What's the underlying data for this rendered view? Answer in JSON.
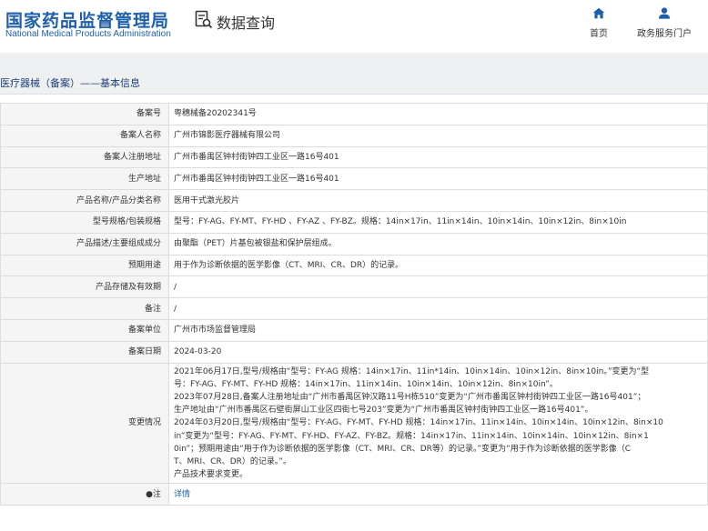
{
  "header": {
    "logo_cn": "国家药品监督管理局",
    "logo_en": "National Medical Products Administration",
    "query_title": "数据查询",
    "nav": [
      {
        "label": "首页",
        "icon": "home-icon"
      },
      {
        "label": "政务服务门户",
        "icon": "user-icon"
      }
    ]
  },
  "breadcrumb": "医疗器械（备案）——基本信息",
  "fields": {
    "record_no": {
      "label": "备案号",
      "value": "粤穗械备20202341号"
    },
    "filer": {
      "label": "备案人名称",
      "value": "广州市锦影医疗器械有限公司"
    },
    "reg_address": {
      "label": "备案人注册地址",
      "value": "广州市番禺区钟村街钟四工业区一路16号401"
    },
    "prod_address": {
      "label": "生产地址",
      "value": "广州市番禺区钟村街钟四工业区一路16号401"
    },
    "product_name": {
      "label": "产品名称/产品分类名称",
      "value": "医用干式激光胶片"
    },
    "model": {
      "label": "型号规格/包装规格",
      "value": "型号：FY-AG、FY-MT、FY-HD 、FY-AZ 、FY-BZ。规格：14in×17in、11in×14in、10in×14in、10in×12in、8in×10in"
    },
    "description": {
      "label": "产品描述/主要组成成分",
      "value": "由聚酯（PET）片基包被银盐和保护层组成。"
    },
    "intended_use": {
      "label": "预期用途",
      "value": "用于作为诊断依据的医学影像（CT、MRI、CR、DR）的记录。"
    },
    "storage": {
      "label": "产品存储及有效期",
      "value": "/"
    },
    "remark": {
      "label": "备注",
      "value": "/"
    },
    "record_unit": {
      "label": "备案单位",
      "value": "广州市市场监督管理局"
    },
    "record_date": {
      "label": "备案日期",
      "value": "2024-03-20"
    },
    "changes": {
      "label": "变更情况",
      "lines": [
        "2021年06月17日,型号/规格由“型号：FY-AG 规格：14in×17in、11in*14in、10in×14in、10in×12in、8in×10in。”变更为“型",
        "号：FY-AG、FY-MT、FY-HD 规格：14in×17in、11in×14in、10in×14in、10in×12in、8in×10in”。",
        "2023年07月28日,备案人注册地址由“广州市番禺区钟汉路11号H栋510”变更为“广州市番禺区钟村街钟四工业区一路16号401”；",
        "生产地址由“广州市番禺区石壁街屏山工业区四街七号203”变更为“广州市番禺区钟村街钟四工业区一路16号401”。",
        "2024年03月20日,型号/规格由“型号：FY-AG、FY-MT、FY-HD 规格：14in×17in、11in×14in、10in×14in、10in×12in、8in×10",
        "in”变更为“型号：FY-AG、FY-MT、FY-HD、FY-AZ、FY-BZ。规格：14in×17in、11in×14in、10in×14in、10in×12in、8in×1",
        "0in”；预期用途由“用于作为诊断依据的医学影像（CT、MRI、CR、DR等）的记录。”变更为“用于作为诊断依据的医学影像（C",
        "T、MRI、CR、DR）的记录。”。",
        "产品技术要求变更。"
      ]
    },
    "note": {
      "label": "●注",
      "link": "详情"
    }
  }
}
